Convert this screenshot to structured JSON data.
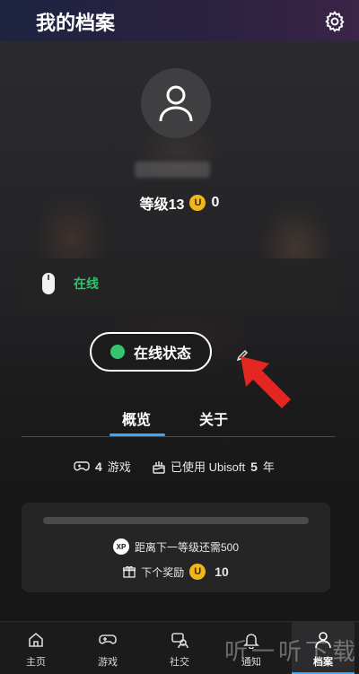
{
  "header": {
    "title": "我的档案"
  },
  "profile": {
    "level_label": "等级13",
    "coin_symbol": "U",
    "coin_count": "0"
  },
  "status_card": {
    "state": "在线"
  },
  "status_button": {
    "label": "在线状态"
  },
  "tabs": [
    {
      "label": "概览",
      "active": true
    },
    {
      "label": "关于",
      "active": false
    }
  ],
  "stats": {
    "games_count": "4",
    "games_label": "游戏",
    "ubisoft_prefix": "已使用 Ubisoft",
    "ubisoft_years": "5",
    "ubisoft_suffix": "年"
  },
  "progress": {
    "xp_fraction": 0.0,
    "xp_badge": "XP",
    "next_level_text": "距离下一等级还需500",
    "reward_label": "下个奖励",
    "reward_coin_symbol": "U",
    "reward_amount": "10"
  },
  "nav": [
    {
      "label": "主页",
      "icon": "home-icon"
    },
    {
      "label": "游戏",
      "icon": "gamepad-icon"
    },
    {
      "label": "社交",
      "icon": "social-icon"
    },
    {
      "label": "通知",
      "icon": "bell-icon"
    },
    {
      "label": "档案",
      "icon": "profile-icon",
      "active": true
    }
  ],
  "watermark": "听一听下载",
  "colors": {
    "online_green": "#2fc46b",
    "accent_blue": "#35a8ff",
    "coin_gold": "#f1b61c",
    "arrow_red": "#e3261f"
  }
}
